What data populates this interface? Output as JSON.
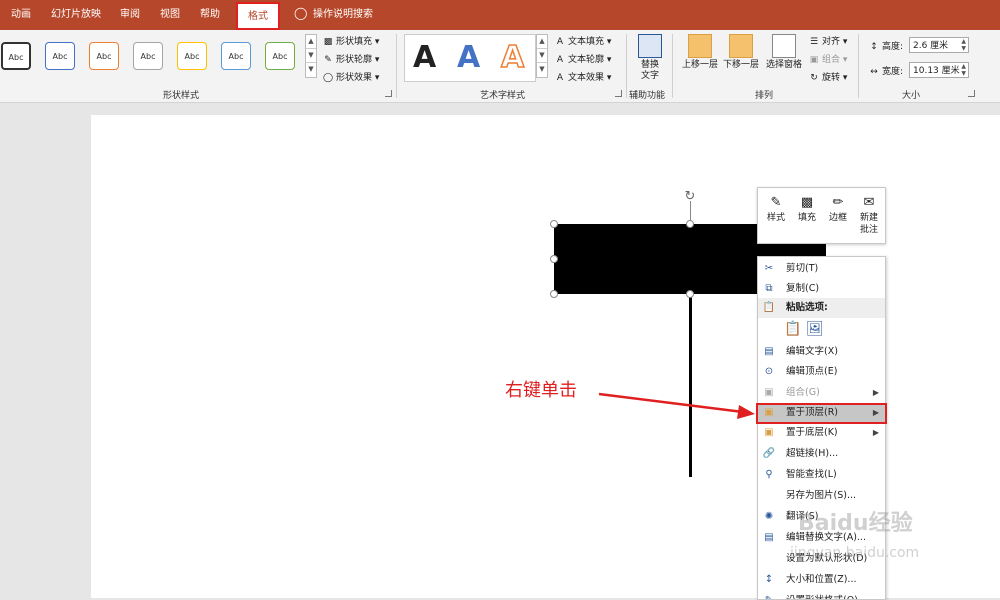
{
  "tabs": [
    {
      "label": "动画"
    },
    {
      "label": "幻灯片放映"
    },
    {
      "label": "审阅"
    },
    {
      "label": "视图"
    },
    {
      "label": "帮助"
    },
    {
      "label": "格式",
      "active": true
    }
  ],
  "tell_me": "操作说明搜索",
  "shape_styles": {
    "thumbs": [
      "Abc",
      "Abc",
      "Abc",
      "Abc",
      "Abc",
      "Abc",
      "Abc"
    ],
    "thumb_colors": [
      "#333333",
      "#4472c4",
      "#ed7d31",
      "#a5a5a5",
      "#ffc000",
      "#5b9bd5",
      "#70ad47"
    ],
    "fill": "形状填充",
    "outline": "形状轮廓",
    "effects": "形状效果",
    "group_label": "形状样式"
  },
  "wordart": {
    "letters": [
      "A",
      "A",
      "A"
    ],
    "letter_colors": [
      "#111111",
      "#4472c4",
      "#ed7d31"
    ],
    "fill": "文本填充",
    "outline": "文本轮廓",
    "effects": "文本效果",
    "group_label": "艺术字样式"
  },
  "accessibility": {
    "alt_text": "替换文字",
    "group_label": "辅助功能"
  },
  "arrange": {
    "bring_forward": "上移一层",
    "send_backward": "下移一层",
    "selection_pane": "选择窗格",
    "align": "对齐",
    "group": "组合",
    "rotate": "旋转",
    "group_label": "排列"
  },
  "size": {
    "height_label": "高度:",
    "height_value": "2.6 厘米",
    "width_label": "宽度:",
    "width_value": "10.13 厘米",
    "group_label": "大小"
  },
  "mini_toolbar": {
    "style": "样式",
    "fill": "填充",
    "border": "边框",
    "new_comment_line1": "新建",
    "new_comment_line2": "批注"
  },
  "context_menu": {
    "items": [
      {
        "label": "剪切(T)"
      },
      {
        "label": "复制(C)"
      },
      {
        "label": "粘贴选项:"
      },
      {
        "label": ""
      },
      {
        "label": "编辑文字(X)"
      },
      {
        "label": "编辑顶点(E)"
      },
      {
        "label": "组合(G)"
      },
      {
        "label": "置于顶层(R)"
      },
      {
        "label": "置于底层(K)"
      },
      {
        "label": "超链接(H)..."
      },
      {
        "label": "智能查找(L)"
      },
      {
        "label": "另存为图片(S)..."
      },
      {
        "label": "翻译(S)"
      },
      {
        "label": "编辑替换文字(A)..."
      },
      {
        "label": "设置为默认形状(D)"
      },
      {
        "label": "大小和位置(Z)..."
      },
      {
        "label": "设置形状格式(O)..."
      }
    ]
  },
  "annotation": "右键单击",
  "watermark": "Baidu经验",
  "watermark_sub": "jingyan.baidu.com"
}
